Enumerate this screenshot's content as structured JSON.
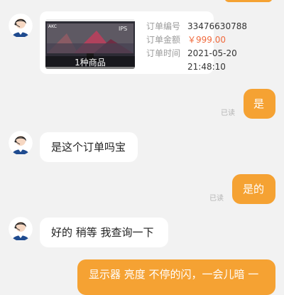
{
  "chat": {
    "order_card": {
      "thumbnail_caption": "1种商品",
      "brand_mark": "AKC",
      "panel_badge": "IPS",
      "fields": [
        {
          "label": "订单编号",
          "value": "33476630788"
        },
        {
          "label": "订单金额",
          "value": "￥999.00"
        },
        {
          "label": "订单时间",
          "value": "2021-05-20"
        },
        {
          "label": "",
          "value": "21:48:10"
        }
      ]
    },
    "messages": [
      {
        "sender": "user",
        "text": "是",
        "read_label": "已读"
      },
      {
        "sender": "agent",
        "text": "是这个订单吗宝"
      },
      {
        "sender": "user",
        "text": "是的",
        "read_label": "已读"
      },
      {
        "sender": "agent",
        "text": "好的  稍等  我查询一下"
      },
      {
        "sender": "user",
        "text": "显示器  亮度  不停的闪，一会儿暗  一"
      }
    ]
  },
  "colors": {
    "page_background": "#f2f2f2",
    "user_bubble": "#f5a233",
    "agent_bubble": "#ffffff",
    "price": "#f06a3d",
    "read_label": "#b3b3b3"
  },
  "icons": {
    "avatar": "customer-service-avatar-icon",
    "thumbnail": "monitor-product-image"
  }
}
